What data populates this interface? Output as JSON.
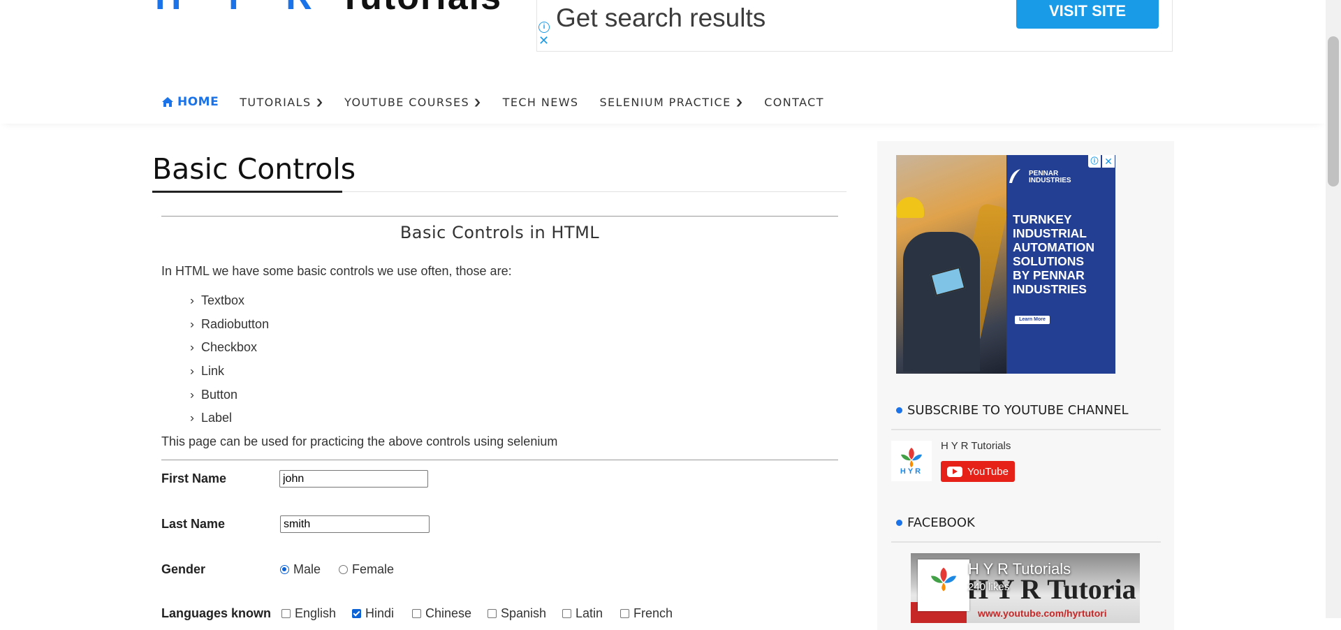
{
  "header": {
    "logo_part1": "H Y R",
    "logo_part2": "Tutorials"
  },
  "top_ad": {
    "headline": "Get search results",
    "cta": "VISIT SITE",
    "info_glyph": "i",
    "close_glyph": "✕"
  },
  "nav": {
    "items": [
      {
        "label": "HOME",
        "icon": "home-icon",
        "active": true
      },
      {
        "label": "TUTORIALS",
        "dropdown": true
      },
      {
        "label": "YOUTUBE COURSES",
        "dropdown": true
      },
      {
        "label": "TECH NEWS",
        "dropdown": false
      },
      {
        "label": "SELENIUM PRACTICE",
        "dropdown": true
      },
      {
        "label": "CONTACT",
        "dropdown": false
      }
    ],
    "chevron": "⌄"
  },
  "main": {
    "title": "Basic Controls",
    "subheading": "Basic Controls in HTML",
    "intro": "In HTML we have some basic controls we use often, those are:",
    "controls": [
      "Textbox",
      "Radiobutton",
      "Checkbox",
      "Link",
      "Button",
      "Label"
    ],
    "bullet": "›",
    "outro": "This page can be used for practicing the above controls using selenium"
  },
  "form": {
    "first_name_label": "First Name",
    "first_name_value": "john",
    "last_name_label": "Last Name",
    "last_name_value": "smith",
    "gender_label": "Gender",
    "gender_options": [
      {
        "label": "Male",
        "selected": true
      },
      {
        "label": "Female",
        "selected": false
      }
    ],
    "languages_label": "Languages known",
    "languages": [
      {
        "label": "English",
        "checked": false
      },
      {
        "label": "Hindi",
        "checked": true
      },
      {
        "label": "Chinese",
        "checked": false
      },
      {
        "label": "Spanish",
        "checked": false
      },
      {
        "label": "Latin",
        "checked": false
      },
      {
        "label": "French",
        "checked": false
      }
    ]
  },
  "sidebar": {
    "ad": {
      "brand_line1": "PENNAR",
      "brand_line2": "INDUSTRIES",
      "tagline": [
        "TURNKEY",
        "INDUSTRIAL",
        "AUTOMATION",
        "SOLUTIONS",
        "BY PENNAR",
        "INDUSTRIES"
      ],
      "learn_more": "Learn More",
      "info_glyph": "ⓘ",
      "close_glyph": "✕"
    },
    "subscribe_heading": "SUBSCRIBE TO YOUTUBE CHANNEL",
    "channel_name": "H Y R Tutorials",
    "youtube_button": "YouTube",
    "facebook_heading": "FACEBOOK",
    "facebook": {
      "page_name": "H Y R Tutorials",
      "likes": "240 likes",
      "banner_text": "H Y R Tutoria",
      "banner_url": "www.youtube.com/hyrtutori"
    },
    "logo_text": "HYR"
  },
  "colors": {
    "accent": "#1a73e8",
    "ad_blue": "#1a9be8",
    "youtube_red": "#e62117",
    "ad_bg": "#233f93"
  }
}
